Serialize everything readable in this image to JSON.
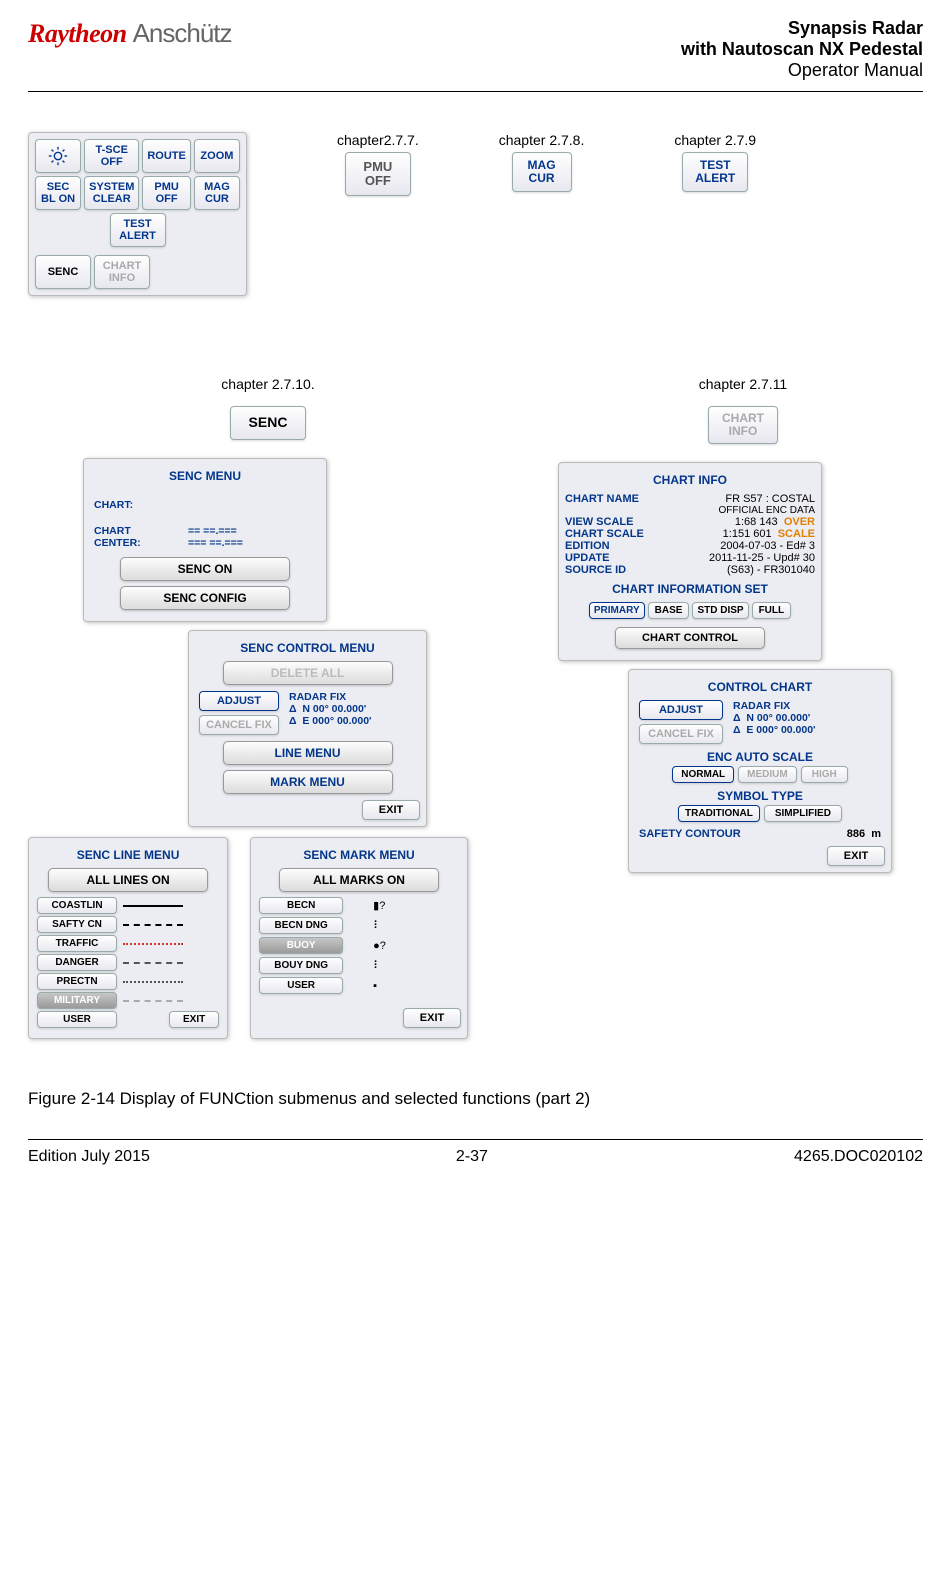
{
  "header": {
    "logo1": "Raytheon",
    "logo2": "Anschütz",
    "title1": "Synapsis Radar",
    "title2": "with Nautoscan NX Pedestal",
    "title3": "Operator Manual"
  },
  "labels": {
    "ch277": "chapter2.7.7.",
    "ch278": "chapter 2.7.8.",
    "ch279": "chapter 2.7.9",
    "ch2710": "chapter 2.7.10.",
    "ch2711": "chapter 2.7.11"
  },
  "top_grid": {
    "r1c1_icon": "sun-icon",
    "r1c2": "T-SCE OFF",
    "r1c3": "ROUTE",
    "r1c4": "ZOOM",
    "r2c1": "SEC BL ON",
    "r2c2": "SYSTEM CLEAR",
    "r2c3": "PMU OFF",
    "r2c4": "MAG CUR",
    "r3": "TEST ALERT",
    "r4c1": "SENC",
    "r4c2": "CHART INFO"
  },
  "callouts": {
    "pmu": "PMU OFF",
    "mag": "MAG CUR",
    "test": "TEST ALERT",
    "senc": "SENC",
    "chart": "CHART INFO"
  },
  "senc_menu": {
    "title": "SENC MENU",
    "chart_lbl": "CHART:",
    "center_lbl": "CHART CENTER:",
    "center_v1": "==  ==.===",
    "center_v2": "===  ==.===",
    "btn_on": "SENC ON",
    "btn_cfg": "SENC CONFIG"
  },
  "senc_control": {
    "title": "SENC CONTROL MENU",
    "delete": "DELETE ALL",
    "adjust": "ADJUST",
    "cancel": "CANCEL FIX",
    "radar_fix": "RADAR FIX",
    "n": "N 00° 00.000'",
    "e": "E 000° 00.000'",
    "line_menu": "LINE MENU",
    "mark_menu": "MARK MENU",
    "exit": "EXIT"
  },
  "senc_line": {
    "title": "SENC LINE MENU",
    "all": "ALL LINES ON",
    "items": [
      "COASTLIN",
      "SAFTY CN",
      "TRAFFIC",
      "DANGER",
      "PRECTN",
      "MILITARY",
      "USER"
    ],
    "exit": "EXIT"
  },
  "senc_mark": {
    "title": "SENC MARK MENU",
    "all": "ALL MARKS ON",
    "items": [
      "BECN",
      "BECN DNG",
      "BUOY",
      "BOUY DNG",
      "USER"
    ],
    "exit": "EXIT"
  },
  "chart_info": {
    "title": "CHART INFO",
    "name_lbl": "CHART NAME",
    "name_v1": "FR S57 : COSTAL",
    "name_v2": "OFFICIAL ENC DATA",
    "view_lbl": "VIEW SCALE",
    "view_v": "1:68 143",
    "over": "OVER",
    "scale_lbl": "CHART SCALE",
    "scale_v": "1:151 601",
    "scale_tag": "SCALE",
    "edition_lbl": "EDITION",
    "edition_v": "2004-07-03 - Ed#   3",
    "update_lbl": "UPDATE",
    "update_v": "2011-11-25 - Upd# 30",
    "source_lbl": "SOURCE ID",
    "source_v": "(S63) - FR301040",
    "info_set": "CHART INFORMATION SET",
    "primary": "PRIMARY",
    "base": "BASE",
    "std": "STD DISP",
    "full": "FULL",
    "chart_control": "CHART CONTROL"
  },
  "control_chart": {
    "title": "CONTROL CHART",
    "adjust": "ADJUST",
    "cancel": "CANCEL FIX",
    "radar_fix": "RADAR FIX",
    "n": "N 00° 00.000'",
    "e": "E 000° 00.000'",
    "enc_auto": "ENC AUTO SCALE",
    "normal": "NORMAL",
    "medium": "MEDIUM",
    "high": "HIGH",
    "symbol": "SYMBOL TYPE",
    "trad": "TRADITIONAL",
    "simp": "SIMPLIFIED",
    "safety": "SAFETY CONTOUR",
    "safety_v": "886",
    "safety_u": "m",
    "exit": "EXIT"
  },
  "caption": "Figure 2-14     Display of FUNCtion submenus and selected functions (part 2)",
  "footer": {
    "left": "Edition July 2015",
    "center": "2-37",
    "right": "4265.DOC020102"
  }
}
